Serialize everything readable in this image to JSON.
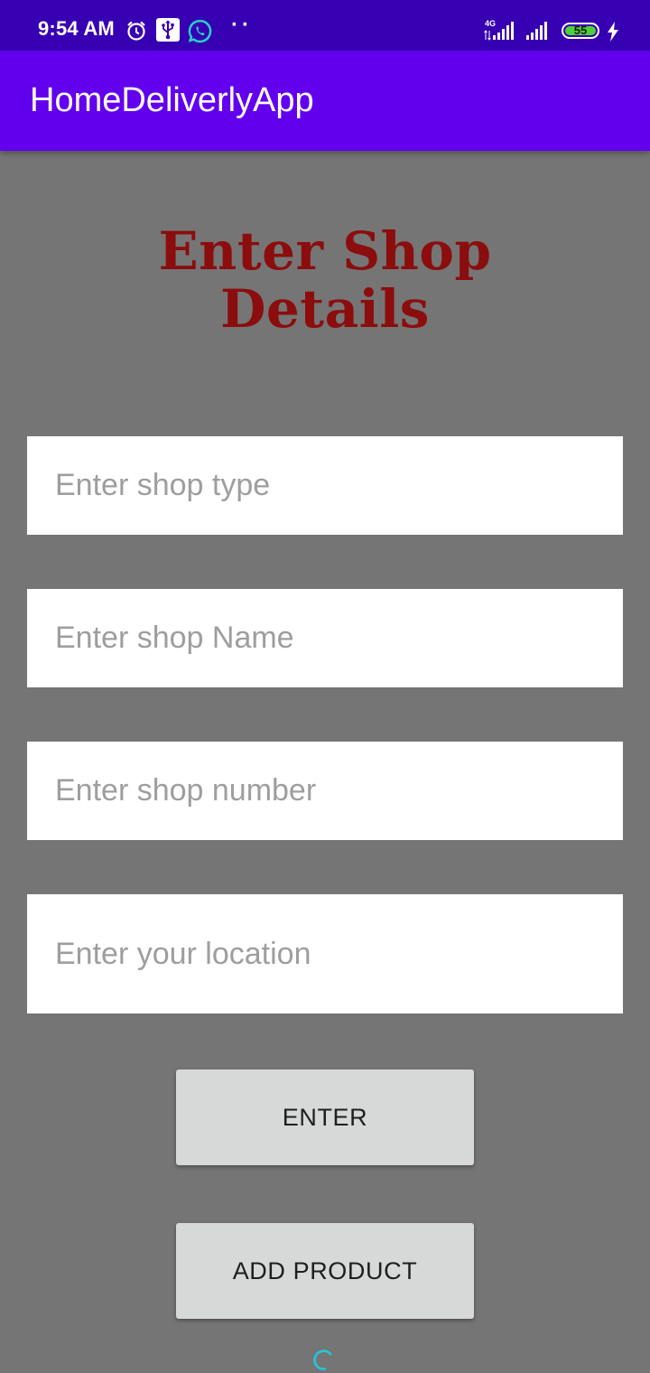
{
  "status_bar": {
    "time": "9:54 AM",
    "icons": [
      "alarm-icon",
      "usb-icon",
      "whatsapp-icon",
      "more-notifications-icon",
      "signal-4g-icon",
      "signal-icon",
      "battery-icon",
      "charging-icon"
    ],
    "network_label": "4G",
    "battery_level": "55"
  },
  "app_bar": {
    "title": "HomeDeliverlyApp",
    "color": "#6200ee"
  },
  "main": {
    "heading": "Enter Shop Details",
    "heading_color": "#8b0d0d",
    "background": "#757575",
    "fields": [
      {
        "placeholder": "Enter shop type",
        "value": ""
      },
      {
        "placeholder": "Enter shop Name",
        "value": ""
      },
      {
        "placeholder": "Enter shop number",
        "value": ""
      },
      {
        "placeholder": "Enter your location",
        "value": ""
      }
    ],
    "enter_button": "ENTER",
    "add_product_button": "ADD PRODUCT",
    "spinner_color": "#26c6da"
  }
}
